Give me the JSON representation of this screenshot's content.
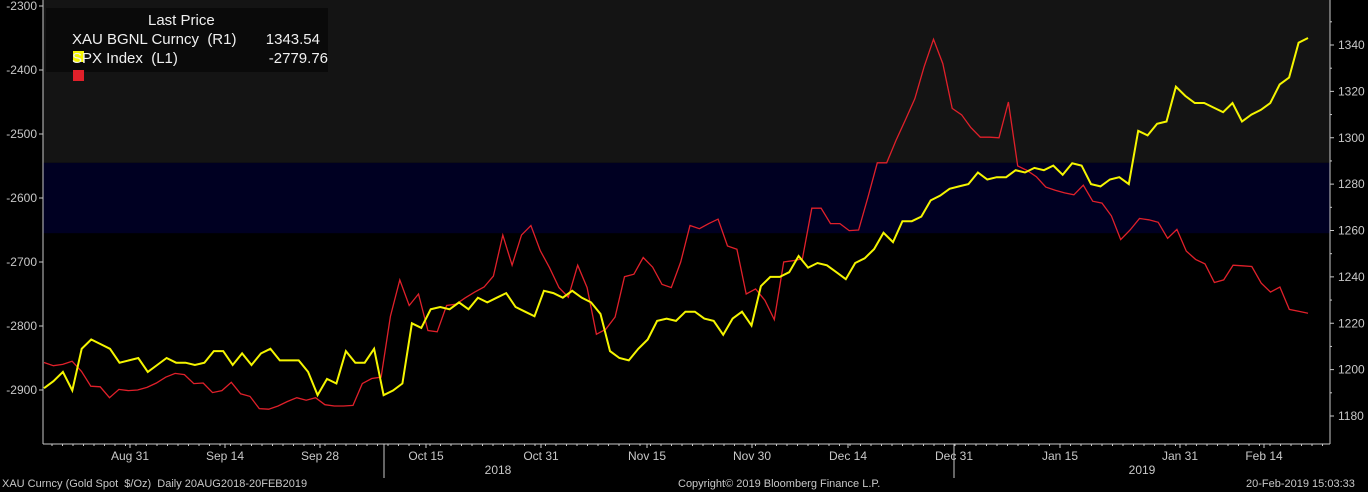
{
  "legend": {
    "title": "Last Price",
    "series": [
      {
        "label": "XAU BGNL Curncy  (R1)",
        "value": "1343.54",
        "color": "#f5f500"
      },
      {
        "label": "SPX Index  (L1)",
        "value": "-2779.76",
        "color": "#e0202a"
      }
    ]
  },
  "footer": {
    "left": "XAU Curncy (Gold Spot  $/Oz)  Daily 20AUG2018-20FEB2019",
    "center": "Copyright© 2019 Bloomberg Finance L.P.",
    "right": "20-Feb-2019 15:03:33"
  },
  "chart_data": {
    "type": "line",
    "x_ticks": [
      "Aug 31",
      "Sep 14",
      "Sep 28",
      "Oct 15",
      "Oct 31",
      "Nov 15",
      "Nov 30",
      "Dec 14",
      "Dec 31",
      "Jan 15",
      "Jan 31",
      "Feb 14"
    ],
    "year_labels": [
      "2018",
      "2019"
    ],
    "left_axis": {
      "ticks": [
        -2300,
        -2400,
        -2500,
        -2600,
        -2700,
        -2800,
        -2900
      ],
      "range": [
        -2300,
        -2960
      ]
    },
    "right_axis": {
      "ticks": [
        1180,
        1200,
        1220,
        1240,
        1260,
        1280,
        1300,
        1320,
        1340
      ],
      "range": [
        1173,
        1352
      ]
    },
    "bands": [
      {
        "from": -2300,
        "to": -2545,
        "color": "#141414"
      },
      {
        "from": -2545,
        "to": -2655,
        "color": "#000022"
      }
    ],
    "series": [
      {
        "name": "XAU BGNL Curncy",
        "axis": "right",
        "color": "#f5f500",
        "values": [
          1192,
          1195,
          1199,
          1191,
          1209,
          1213,
          1211,
          1209,
          1203,
          1204,
          1205,
          1199,
          1202,
          1205,
          1203,
          1203,
          1202,
          1203,
          1208,
          1208,
          1202,
          1207,
          1202,
          1207,
          1209,
          1204,
          1204,
          1204,
          1199,
          1189,
          1196,
          1194,
          1208,
          1203,
          1203,
          1209,
          1189,
          1191,
          1194,
          1220,
          1218,
          1226,
          1227,
          1226,
          1229,
          1226,
          1231,
          1229,
          1231,
          1233,
          1227,
          1225,
          1223,
          1234,
          1233,
          1231,
          1234,
          1231,
          1229,
          1224,
          1208,
          1205,
          1204,
          1209,
          1213,
          1221,
          1222,
          1221,
          1225,
          1225,
          1222,
          1221,
          1215,
          1222,
          1225,
          1219,
          1236,
          1240,
          1240,
          1242,
          1249,
          1244,
          1246,
          1245,
          1242,
          1239,
          1246,
          1248,
          1252,
          1259,
          1255,
          1264,
          1264,
          1266,
          1273,
          1275,
          1278,
          1279,
          1280,
          1285,
          1282,
          1283,
          1283,
          1286,
          1285,
          1287,
          1286,
          1288,
          1284,
          1289,
          1288,
          1280,
          1279,
          1282,
          1283,
          1280,
          1303,
          1301,
          1306,
          1307,
          1322,
          1318,
          1315,
          1315,
          1313,
          1311,
          1315,
          1307,
          1310,
          1312,
          1315,
          1323,
          1326,
          1341,
          1343
        ]
      },
      {
        "name": "SPX Index",
        "axis": "left",
        "color": "#e0202a",
        "values": [
          2857,
          2862,
          2860,
          2855,
          2871,
          2894,
          2895,
          2912,
          2899,
          2901,
          2900,
          2896,
          2889,
          2880,
          2874,
          2876,
          2890,
          2889,
          2904,
          2901,
          2888,
          2906,
          2910,
          2929,
          2930,
          2925,
          2918,
          2912,
          2916,
          2912,
          2923,
          2925,
          2925,
          2924,
          2890,
          2882,
          2880,
          2785,
          2728,
          2768,
          2750,
          2807,
          2809,
          2768,
          2766,
          2756,
          2747,
          2739,
          2722,
          2658,
          2705,
          2658,
          2643,
          2682,
          2709,
          2740,
          2755,
          2705,
          2740,
          2813,
          2805,
          2786,
          2723,
          2719,
          2693,
          2708,
          2735,
          2740,
          2700,
          2643,
          2648,
          2640,
          2633,
          2675,
          2680,
          2750,
          2742,
          2760,
          2790,
          2700,
          2698,
          2695,
          2616,
          2616,
          2640,
          2640,
          2651,
          2650,
          2599,
          2545,
          2545,
          2510,
          2478,
          2445,
          2395,
          2352,
          2390,
          2460,
          2470,
          2490,
          2505,
          2505,
          2506,
          2450,
          2550,
          2557,
          2567,
          2583,
          2588,
          2592,
          2595,
          2580,
          2605,
          2608,
          2628,
          2665,
          2650,
          2632,
          2634,
          2638,
          2663,
          2649,
          2683,
          2696,
          2703,
          2732,
          2728,
          2705,
          2706,
          2707,
          2733,
          2747,
          2739,
          2774,
          2777,
          2780
        ]
      }
    ]
  }
}
